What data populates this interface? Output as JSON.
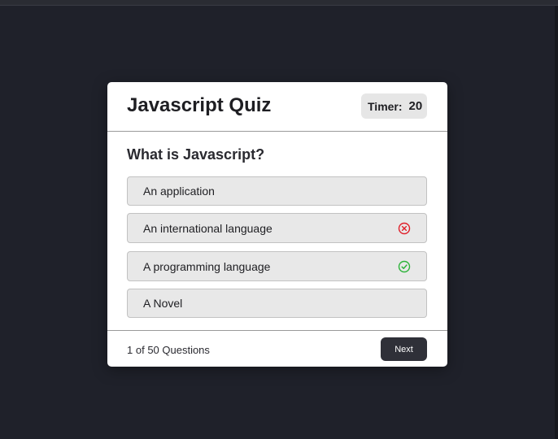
{
  "quiz": {
    "title": "Javascript Quiz",
    "timer_label": "Timer:",
    "timer_value": "20",
    "question": "What is Javascript?",
    "options": [
      {
        "label": "An application",
        "status": "none"
      },
      {
        "label": "An international language",
        "status": "incorrect"
      },
      {
        "label": "A programming language",
        "status": "correct"
      },
      {
        "label": "A Novel",
        "status": "none"
      }
    ],
    "progress": {
      "current": "1",
      "text": "of 50 Questions"
    },
    "next_label": "Next"
  },
  "colors": {
    "page_background": "#1f212a",
    "card_background": "#ffffff",
    "option_background": "#e8e8e8",
    "incorrect": "#e0202a",
    "correct": "#2db33a",
    "button": "#2f3038"
  },
  "icons": {
    "incorrect": "x-circle-icon",
    "correct": "check-circle-icon"
  }
}
